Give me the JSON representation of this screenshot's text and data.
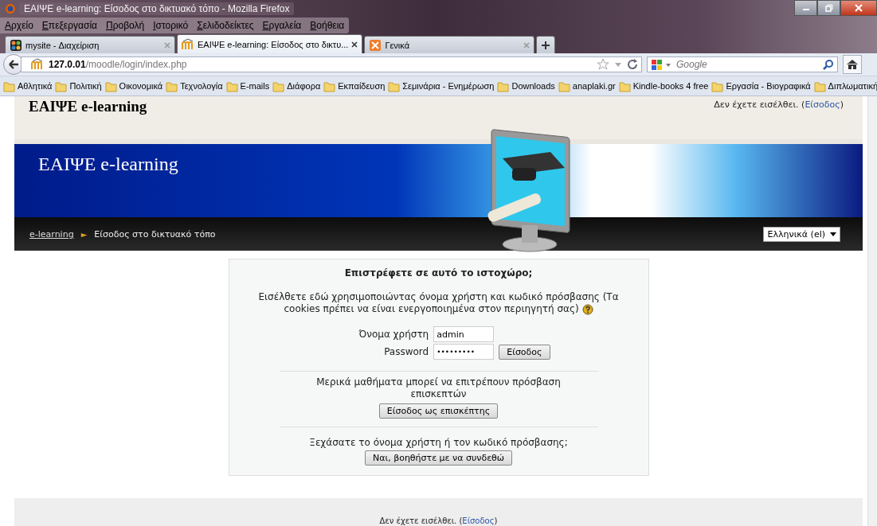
{
  "window": {
    "title": "ΕΑΙΨΕ e-learning: Είσοδος στο δικτυακό τόπο - Mozilla Firefox"
  },
  "menu": [
    "Αρχείο",
    "Επεξεργασία",
    "Προβολή",
    "Ιστορικό",
    "Σελιδοδείκτες",
    "Εργαλεία",
    "Βοήθεια"
  ],
  "tabs": [
    {
      "label": "mysite - Διαχείριση",
      "selected": false,
      "kind": "joomla"
    },
    {
      "label": "ΕΑΙΨΕ e-learning: Είσοδος στο δικτυ...",
      "selected": true,
      "kind": "moodle"
    },
    {
      "label": "Γενικά",
      "selected": false,
      "kind": "xampp"
    }
  ],
  "address": {
    "host": "127.0.01",
    "path": "/moodle/login/index.php"
  },
  "search": {
    "placeholder": "Google"
  },
  "bookmarks": [
    "Αθλητικά",
    "Πολιτική",
    "Οικονομικά",
    "Τεχνολογία",
    "E-mails",
    "Διάφορα",
    "Εκπαίδευση",
    "Σεμινάρια - Ενημέρωση",
    "Downloads",
    "anaplaki.gr",
    "Kindle-books 4 free",
    "Εργασία - Βιογραφικά",
    "Διπλωματική"
  ],
  "header": {
    "site_name": "ΕΑΙΨΕ e-learning",
    "login_prefix": "Δεν έχετε εισέλθει. (",
    "login_link": "Είσοδος",
    "login_suffix": ")"
  },
  "banner": {
    "title": "ΕΑΙΨΕ e-learning"
  },
  "breadcrumb": {
    "home": "e-learning",
    "separator": "►",
    "current": "Είσοδος στο δικτυακό τόπο"
  },
  "language": "Ελληνικά (el)",
  "login": {
    "heading": "Επιστρέφετε σε αυτό το ιστοχώρο;",
    "intro": "Εισέλθετε εδώ χρησιμοποιώντας όνομα χρήστη και κωδικό πρόσβασης (Τα cookies πρέπει να είναι ενεργοποιημένα στον περιηγητή σας)",
    "username_label": "Όνομα χρήστη",
    "username": "admin",
    "password_label": "Password",
    "password": "•••••••••",
    "submit": "Είσοδος",
    "guest_text": "Μερικά μαθήματα μπορεί να επιτρέπουν πρόσβαση επισκεπτών",
    "guest_button": "Είσοδος ως επισκέπτης",
    "forgot_text": "Ξεχάσατε το όνομα χρήστη ή τον κωδικό πρόσβασης;",
    "forgot_button": "Ναι, βοηθήστε με να συνδεθώ"
  },
  "footer": {
    "login_prefix": "Δεν έχετε εισέλθει. (",
    "login_link": "Είσοδος",
    "login_suffix": ")"
  }
}
